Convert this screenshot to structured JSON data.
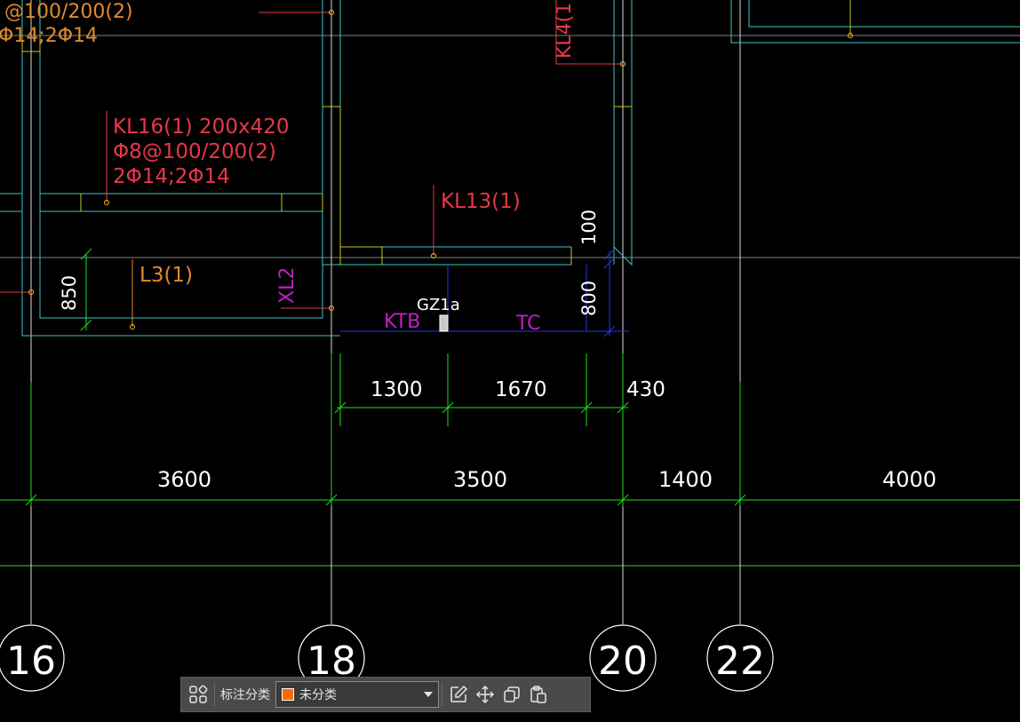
{
  "colors": {
    "grid": "#1fe01f",
    "axis": "#d8d8d8",
    "beam_cyan": "#38c8c8",
    "wall_yellow": "#c8c820",
    "label_red": "#e8384a",
    "label_orange": "#e08a2c",
    "label_magenta": "#c020c0",
    "line_blue": "#2038e8",
    "text_white": "#ffffff",
    "swatch": "#ff6a00"
  },
  "labels": {
    "top_left_1": "@100/200(2)",
    "top_left_2": "Φ14;2Φ14",
    "kl4": "KL4(1",
    "kl16_line1": "KL16(1) 200x420",
    "kl16_line2": "Φ8@100/200(2)",
    "kl16_line3": "2Φ14;2Φ14",
    "kl13": "KL13(1)",
    "l3": "L3(1)",
    "xl2": "XL2",
    "ktb": "KTB",
    "tc": "TC",
    "gz1a": "GZ1a"
  },
  "dimensions": {
    "d850": "850",
    "d100": "100",
    "d800": "800",
    "d1300": "1300",
    "d1670": "1670",
    "d430": "430",
    "d3600": "3600",
    "d3500": "3500",
    "d1400": "1400",
    "d4000": "4000"
  },
  "axes": [
    "16",
    "18",
    "20",
    "22"
  ],
  "toolbar": {
    "label": "标注分类",
    "selected": "未分类",
    "icons": [
      "grid-icon",
      "edit-icon",
      "move-icon",
      "copy-icon",
      "paste-icon"
    ]
  }
}
